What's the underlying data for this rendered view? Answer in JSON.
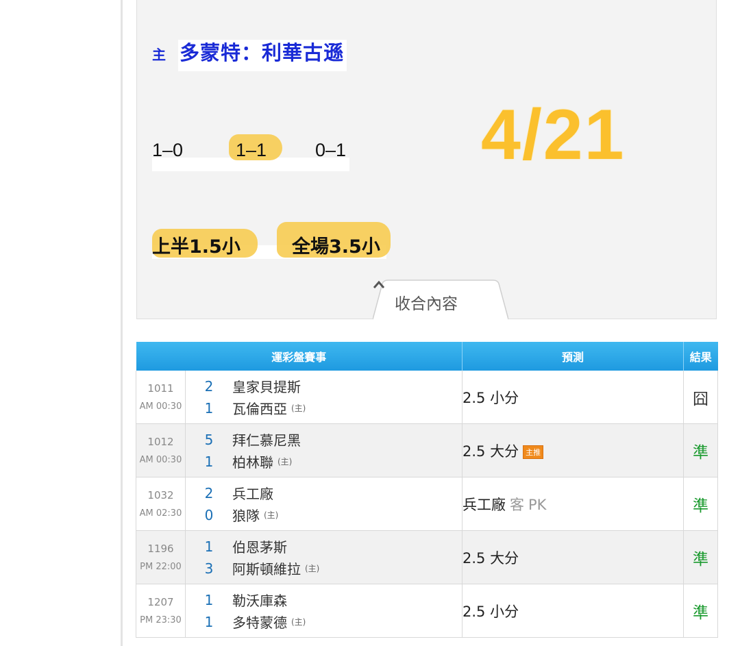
{
  "post": {
    "home_tag": "主",
    "match_name": "多蒙特：利華古遜",
    "scores": [
      "1–0",
      "1–1",
      "0–1"
    ],
    "date": "4/21",
    "ou_picks": [
      "上半1.5小",
      "全場3.5小"
    ],
    "collapse_label": "收合內容"
  },
  "table": {
    "headers": [
      "運彩盤賽事",
      "預測",
      "結果"
    ],
    "home_mark": "(主)",
    "rows": [
      {
        "id": "1011",
        "time": "AM 00:30",
        "away_score": "2",
        "away_team": "皇家貝提斯",
        "home_score": "1",
        "home_team": "瓦倫西亞",
        "prediction": "2.5 小分",
        "result": "囧",
        "result_type": "miss"
      },
      {
        "id": "1012",
        "time": "AM 00:30",
        "away_score": "5",
        "away_team": "拜仁慕尼黑",
        "home_score": "1",
        "home_team": "柏林聯",
        "prediction": "2.5 大分",
        "badge": "主推",
        "result": "準",
        "result_type": "hit"
      },
      {
        "id": "1032",
        "time": "AM 02:30",
        "away_score": "2",
        "away_team": "兵工廠",
        "home_score": "0",
        "home_team": "狼隊",
        "prediction": "兵工廠",
        "prediction_away": "客",
        "prediction_pk": "PK",
        "result": "準",
        "result_type": "hit"
      },
      {
        "id": "1196",
        "time": "PM 22:00",
        "away_score": "1",
        "away_team": "伯恩茅斯",
        "home_score": "3",
        "home_team": "阿斯頓維拉",
        "prediction": "2.5 大分",
        "result": "準",
        "result_type": "hit"
      },
      {
        "id": "1207",
        "time": "PM 23:30",
        "away_score": "1",
        "away_team": "勒沃庫森",
        "home_score": "1",
        "home_team": "多特蒙德",
        "prediction": "2.5 小分",
        "result": "準",
        "result_type": "hit"
      }
    ]
  },
  "colors": {
    "match_name": "#1a2bd6",
    "date_highlight": "#fbc02d",
    "header_bg": "#1e9ae0",
    "hit": "#1a9a2e"
  }
}
